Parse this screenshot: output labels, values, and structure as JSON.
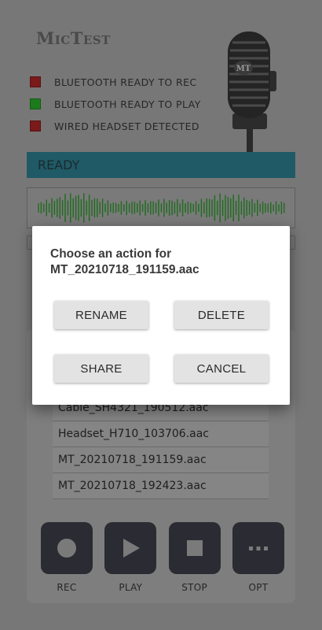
{
  "app": {
    "title": "MicTest"
  },
  "indicators": [
    {
      "label": "BLUETOOTH READY TO REC",
      "color": "#7a1a1a"
    },
    {
      "label": "BLUETOOTH READY TO PLAY",
      "color": "#1d7a1d"
    },
    {
      "label": "WIRED HEADSET DETECTED",
      "color": "#7a1a1a"
    }
  ],
  "mic": {
    "logo": "MT"
  },
  "status": {
    "text": "READY"
  },
  "waveform": {
    "color": "#1e6b1e"
  },
  "files": [
    "Cable_SH4321_190512.aac",
    "Headset_H710_103706.aac",
    "MT_20210718_191159.aac",
    "MT_20210718_192423.aac"
  ],
  "controls": [
    {
      "label": "REC",
      "icon": "record-icon"
    },
    {
      "label": "PLAY",
      "icon": "play-icon"
    },
    {
      "label": "STOP",
      "icon": "stop-icon"
    },
    {
      "label": "OPT",
      "icon": "more-icon"
    }
  ],
  "dialog": {
    "title_line1": "Choose an action for",
    "title_line2": "MT_20210718_191159.aac",
    "rename": "RENAME",
    "delete": "DELETE",
    "share": "SHARE",
    "cancel": "CANCEL"
  },
  "colors": {
    "background": "#777777",
    "status_bar": "#1f5a66",
    "control_button": "#2b2b33",
    "icon": "#7a7a7a"
  }
}
